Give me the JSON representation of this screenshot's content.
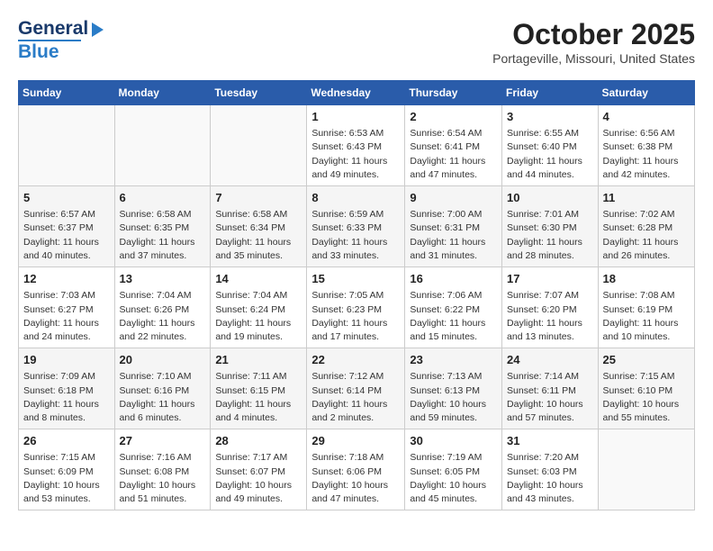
{
  "header": {
    "logo_line1": "General",
    "logo_line2": "Blue",
    "month": "October 2025",
    "location": "Portageville, Missouri, United States"
  },
  "weekdays": [
    "Sunday",
    "Monday",
    "Tuesday",
    "Wednesday",
    "Thursday",
    "Friday",
    "Saturday"
  ],
  "weeks": [
    [
      {
        "day": "",
        "info": ""
      },
      {
        "day": "",
        "info": ""
      },
      {
        "day": "",
        "info": ""
      },
      {
        "day": "1",
        "info": "Sunrise: 6:53 AM\nSunset: 6:43 PM\nDaylight: 11 hours\nand 49 minutes."
      },
      {
        "day": "2",
        "info": "Sunrise: 6:54 AM\nSunset: 6:41 PM\nDaylight: 11 hours\nand 47 minutes."
      },
      {
        "day": "3",
        "info": "Sunrise: 6:55 AM\nSunset: 6:40 PM\nDaylight: 11 hours\nand 44 minutes."
      },
      {
        "day": "4",
        "info": "Sunrise: 6:56 AM\nSunset: 6:38 PM\nDaylight: 11 hours\nand 42 minutes."
      }
    ],
    [
      {
        "day": "5",
        "info": "Sunrise: 6:57 AM\nSunset: 6:37 PM\nDaylight: 11 hours\nand 40 minutes."
      },
      {
        "day": "6",
        "info": "Sunrise: 6:58 AM\nSunset: 6:35 PM\nDaylight: 11 hours\nand 37 minutes."
      },
      {
        "day": "7",
        "info": "Sunrise: 6:58 AM\nSunset: 6:34 PM\nDaylight: 11 hours\nand 35 minutes."
      },
      {
        "day": "8",
        "info": "Sunrise: 6:59 AM\nSunset: 6:33 PM\nDaylight: 11 hours\nand 33 minutes."
      },
      {
        "day": "9",
        "info": "Sunrise: 7:00 AM\nSunset: 6:31 PM\nDaylight: 11 hours\nand 31 minutes."
      },
      {
        "day": "10",
        "info": "Sunrise: 7:01 AM\nSunset: 6:30 PM\nDaylight: 11 hours\nand 28 minutes."
      },
      {
        "day": "11",
        "info": "Sunrise: 7:02 AM\nSunset: 6:28 PM\nDaylight: 11 hours\nand 26 minutes."
      }
    ],
    [
      {
        "day": "12",
        "info": "Sunrise: 7:03 AM\nSunset: 6:27 PM\nDaylight: 11 hours\nand 24 minutes."
      },
      {
        "day": "13",
        "info": "Sunrise: 7:04 AM\nSunset: 6:26 PM\nDaylight: 11 hours\nand 22 minutes."
      },
      {
        "day": "14",
        "info": "Sunrise: 7:04 AM\nSunset: 6:24 PM\nDaylight: 11 hours\nand 19 minutes."
      },
      {
        "day": "15",
        "info": "Sunrise: 7:05 AM\nSunset: 6:23 PM\nDaylight: 11 hours\nand 17 minutes."
      },
      {
        "day": "16",
        "info": "Sunrise: 7:06 AM\nSunset: 6:22 PM\nDaylight: 11 hours\nand 15 minutes."
      },
      {
        "day": "17",
        "info": "Sunrise: 7:07 AM\nSunset: 6:20 PM\nDaylight: 11 hours\nand 13 minutes."
      },
      {
        "day": "18",
        "info": "Sunrise: 7:08 AM\nSunset: 6:19 PM\nDaylight: 11 hours\nand 10 minutes."
      }
    ],
    [
      {
        "day": "19",
        "info": "Sunrise: 7:09 AM\nSunset: 6:18 PM\nDaylight: 11 hours\nand 8 minutes."
      },
      {
        "day": "20",
        "info": "Sunrise: 7:10 AM\nSunset: 6:16 PM\nDaylight: 11 hours\nand 6 minutes."
      },
      {
        "day": "21",
        "info": "Sunrise: 7:11 AM\nSunset: 6:15 PM\nDaylight: 11 hours\nand 4 minutes."
      },
      {
        "day": "22",
        "info": "Sunrise: 7:12 AM\nSunset: 6:14 PM\nDaylight: 11 hours\nand 2 minutes."
      },
      {
        "day": "23",
        "info": "Sunrise: 7:13 AM\nSunset: 6:13 PM\nDaylight: 10 hours\nand 59 minutes."
      },
      {
        "day": "24",
        "info": "Sunrise: 7:14 AM\nSunset: 6:11 PM\nDaylight: 10 hours\nand 57 minutes."
      },
      {
        "day": "25",
        "info": "Sunrise: 7:15 AM\nSunset: 6:10 PM\nDaylight: 10 hours\nand 55 minutes."
      }
    ],
    [
      {
        "day": "26",
        "info": "Sunrise: 7:15 AM\nSunset: 6:09 PM\nDaylight: 10 hours\nand 53 minutes."
      },
      {
        "day": "27",
        "info": "Sunrise: 7:16 AM\nSunset: 6:08 PM\nDaylight: 10 hours\nand 51 minutes."
      },
      {
        "day": "28",
        "info": "Sunrise: 7:17 AM\nSunset: 6:07 PM\nDaylight: 10 hours\nand 49 minutes."
      },
      {
        "day": "29",
        "info": "Sunrise: 7:18 AM\nSunset: 6:06 PM\nDaylight: 10 hours\nand 47 minutes."
      },
      {
        "day": "30",
        "info": "Sunrise: 7:19 AM\nSunset: 6:05 PM\nDaylight: 10 hours\nand 45 minutes."
      },
      {
        "day": "31",
        "info": "Sunrise: 7:20 AM\nSunset: 6:03 PM\nDaylight: 10 hours\nand 43 minutes."
      },
      {
        "day": "",
        "info": ""
      }
    ]
  ]
}
